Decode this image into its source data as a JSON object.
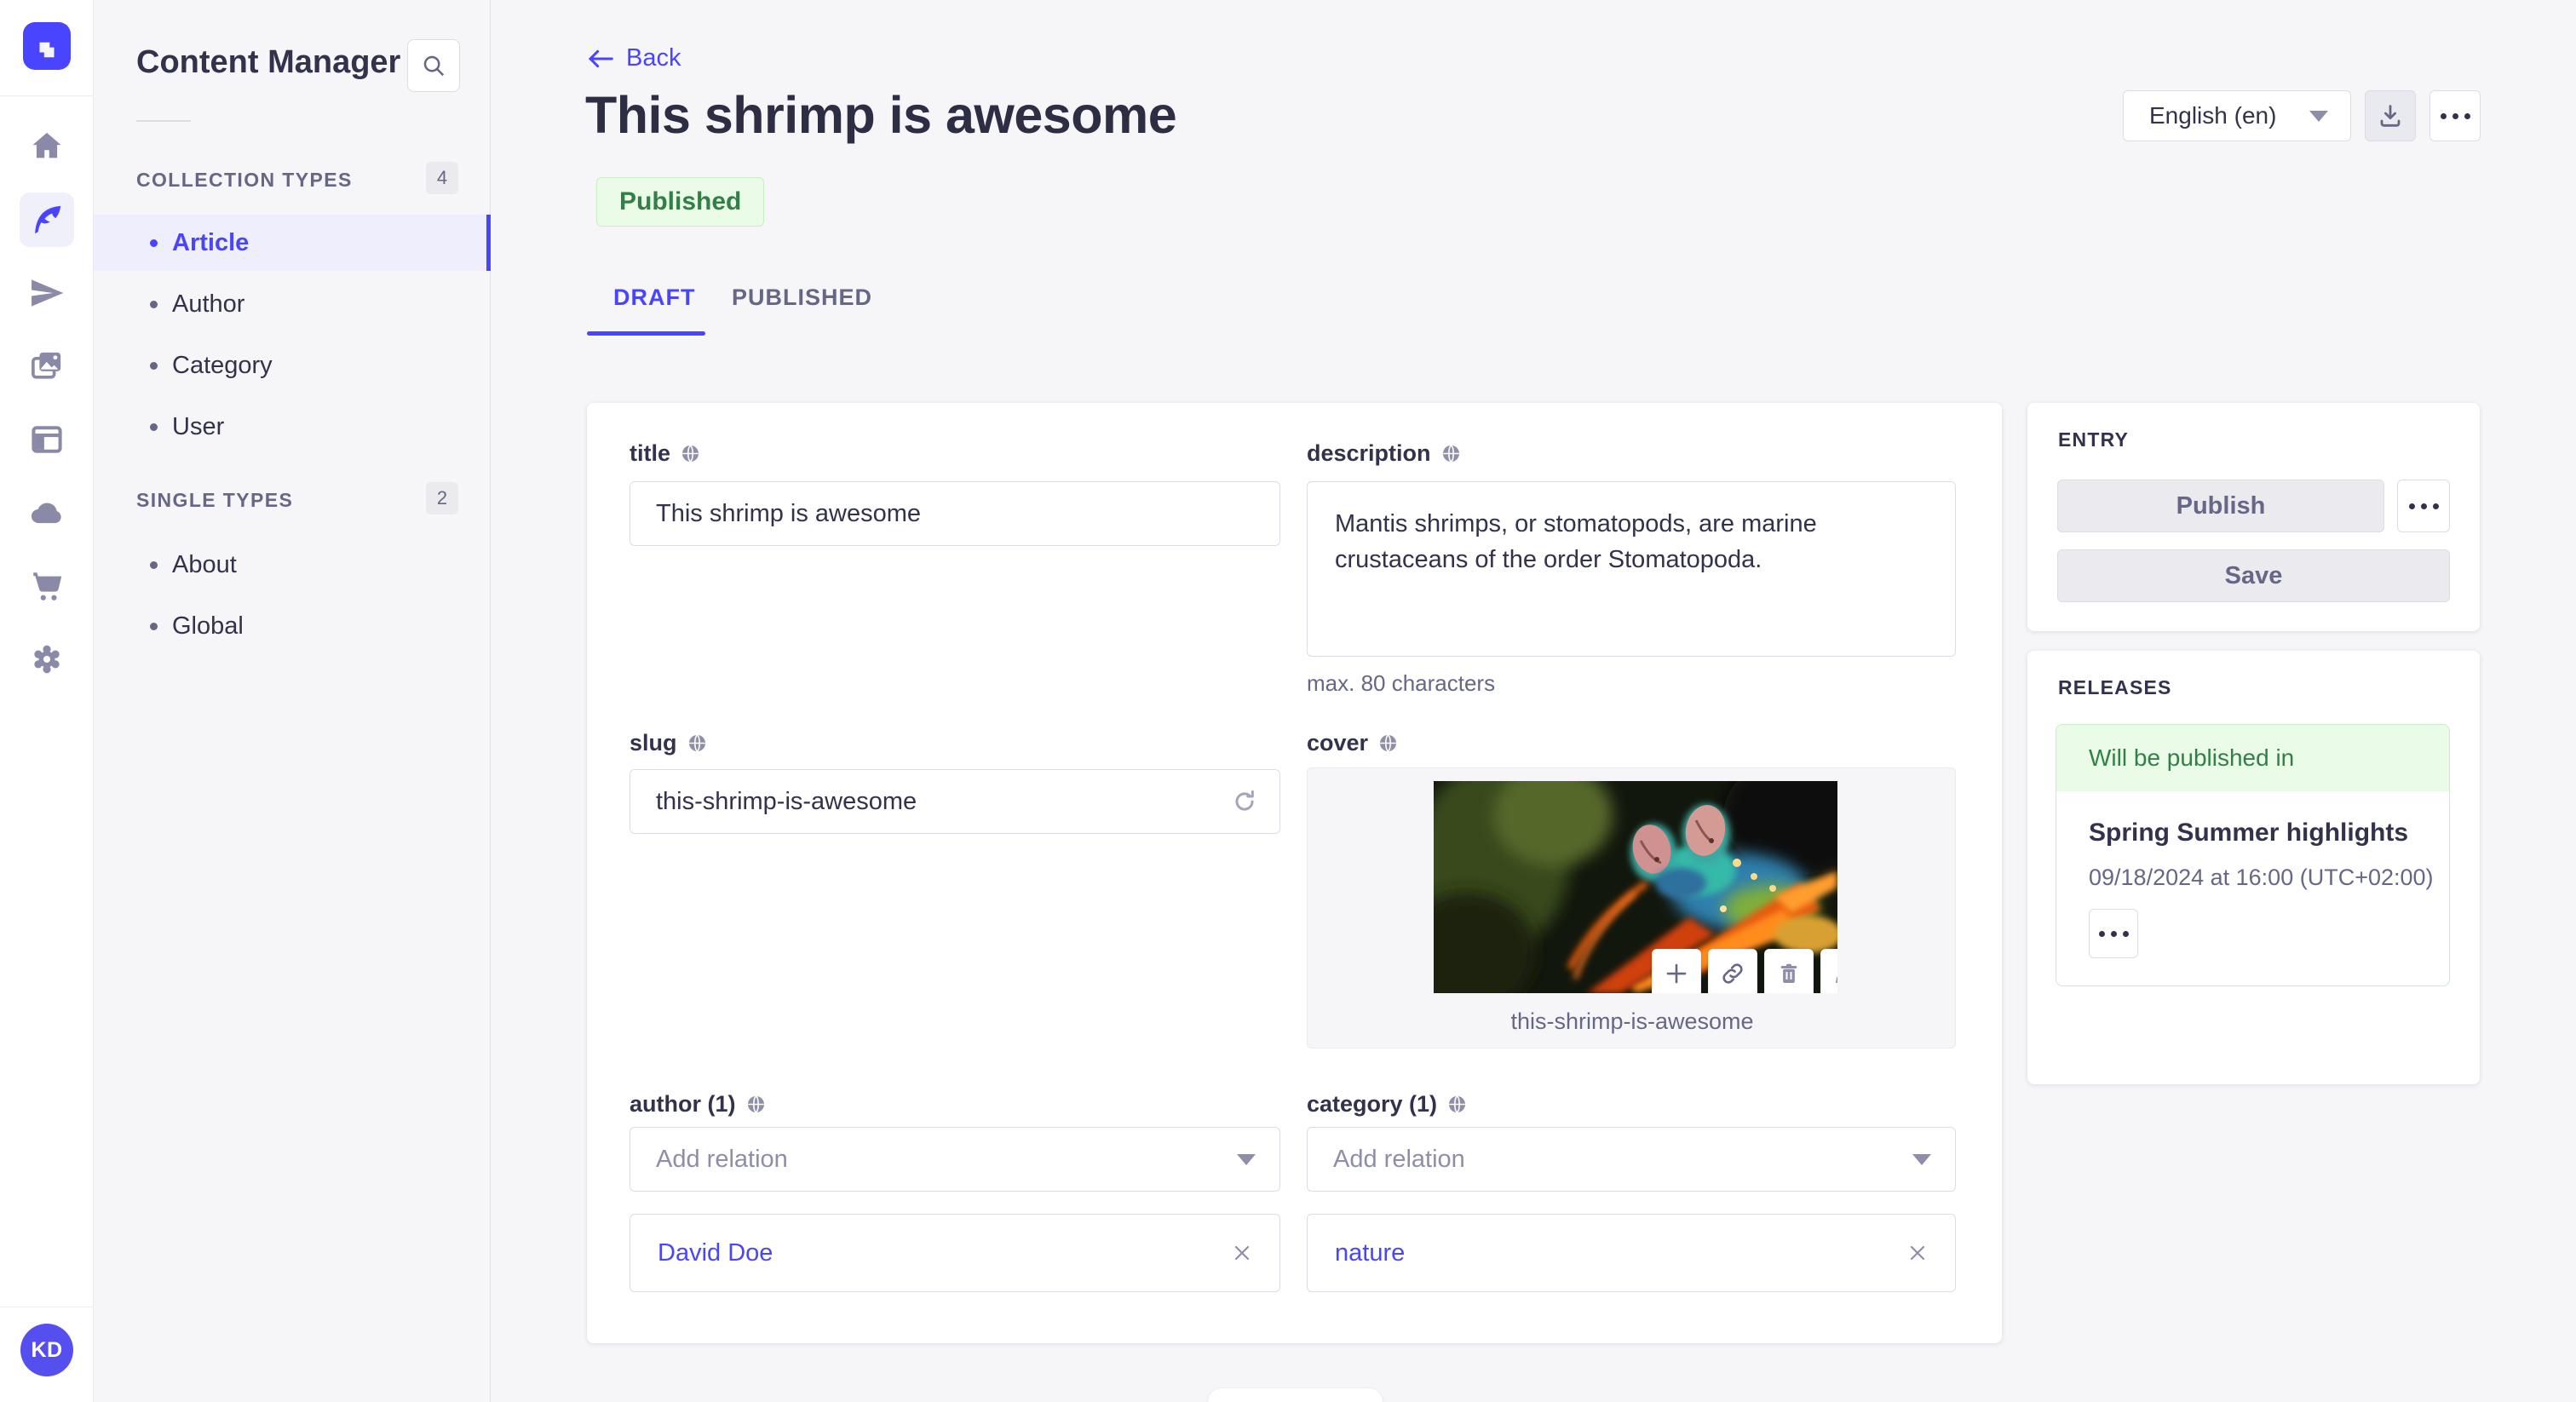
{
  "colors": {
    "primary": "#4945ff",
    "success_text": "#328048",
    "success_bg": "#eafbe7",
    "success_border": "#c6f0c2",
    "background": "#f6f6f9"
  },
  "nav_rail": {
    "avatar_initials": "KD"
  },
  "sidebar": {
    "title": "Content Manager",
    "sections": [
      {
        "label": "COLLECTION TYPES",
        "badge": "4",
        "items": [
          {
            "label": "Article",
            "active": true
          },
          {
            "label": "Author"
          },
          {
            "label": "Category"
          },
          {
            "label": "User"
          }
        ]
      },
      {
        "label": "SINGLE TYPES",
        "badge": "2",
        "items": [
          {
            "label": "About"
          },
          {
            "label": "Global"
          }
        ]
      }
    ]
  },
  "header": {
    "back_label": "Back",
    "title": "This shrimp is awesome",
    "status_badge": "Published",
    "tabs": [
      {
        "label": "DRAFT",
        "active": true
      },
      {
        "label": "PUBLISHED"
      }
    ],
    "locale_selector": "English (en)"
  },
  "form": {
    "title": {
      "label": "title",
      "value": "This shrimp is awesome"
    },
    "description": {
      "label": "description",
      "value": "Mantis shrimps, or stomatopods, are marine crustaceans of the order Stomatopoda.",
      "helper": "max. 80 characters"
    },
    "slug": {
      "label": "slug",
      "value": "this-shrimp-is-awesome"
    },
    "cover": {
      "label": "cover",
      "filename": "this-shrimp-is-awesome"
    },
    "author": {
      "label": "author (1)",
      "placeholder": "Add relation",
      "relation": "David Doe"
    },
    "category": {
      "label": "category (1)",
      "placeholder": "Add relation",
      "relation": "nature"
    }
  },
  "entry_panel": {
    "title": "ENTRY",
    "publish_label": "Publish",
    "save_label": "Save"
  },
  "releases_panel": {
    "title": "RELEASES",
    "status": "Will be published in",
    "release_name": "Spring Summer highlights",
    "release_date": "09/18/2024 at 16:00 (UTC+02:00)"
  }
}
